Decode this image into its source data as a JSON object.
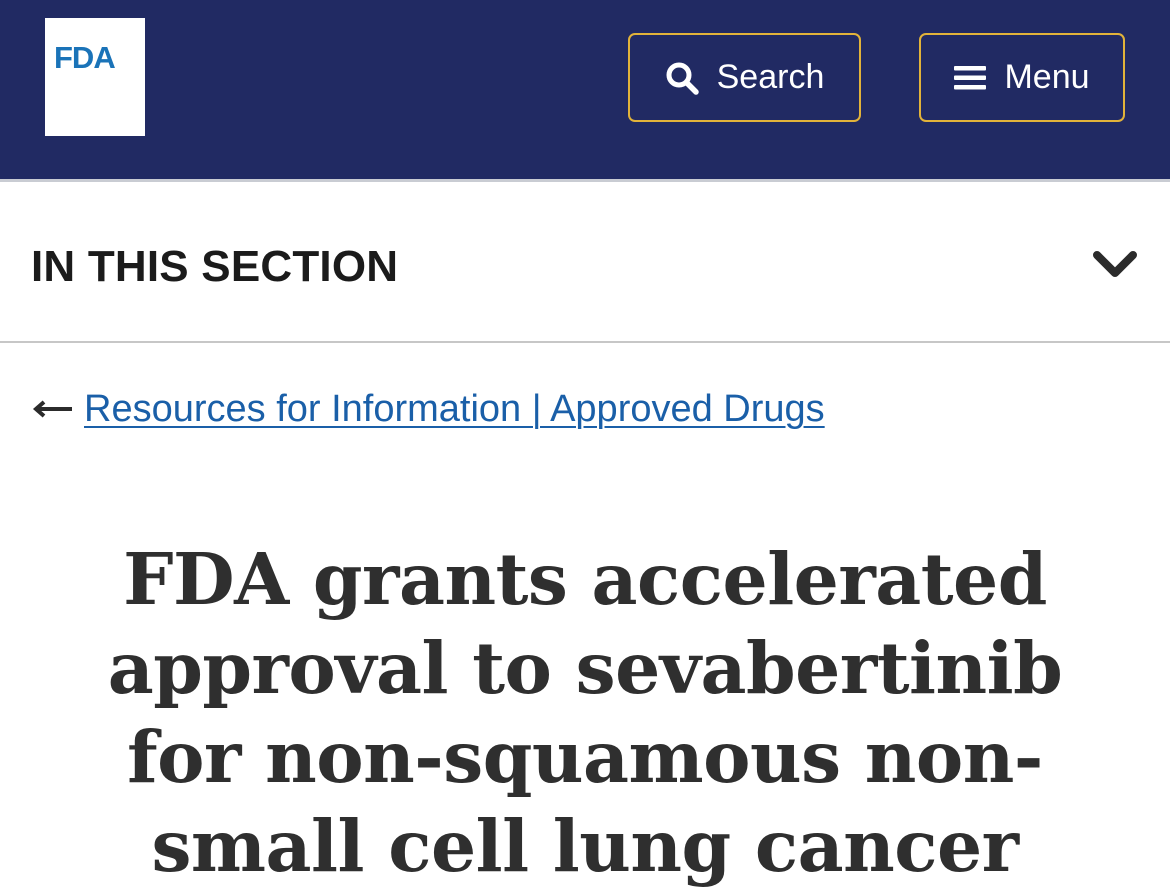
{
  "header": {
    "logo_text": "FDA",
    "search_label": "Search",
    "menu_label": "Menu",
    "background_color": "#212a63",
    "button_border_color": "#e2b33a",
    "icons": {
      "search": "search-icon",
      "menu": "hamburger-icon"
    }
  },
  "section": {
    "title": "IN THIS SECTION",
    "toggle_icon": "chevron-down-icon"
  },
  "breadcrumb": {
    "arrow_icon": "arrow-left-icon",
    "link_text": "Resources for Information | Approved Drugs",
    "link_color": "#1a5fa8"
  },
  "article": {
    "title": "FDA grants accelerated approval to sevabertinib for non-squamous non-small cell lung cancer"
  }
}
